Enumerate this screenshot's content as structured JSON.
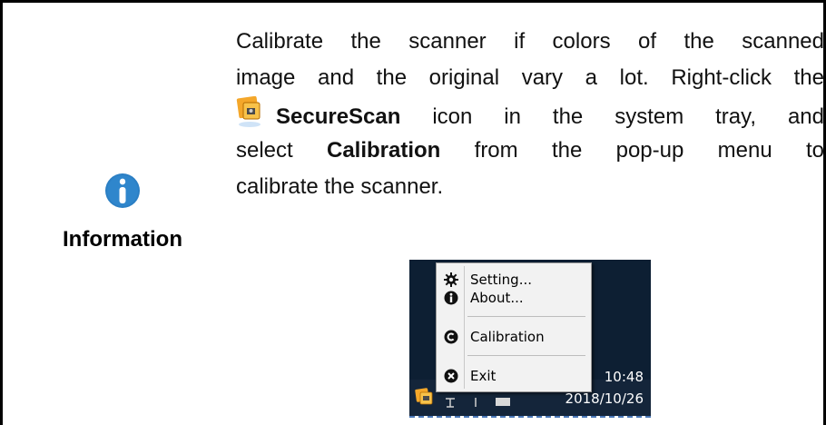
{
  "note": {
    "label": "Information",
    "icon": "info-icon",
    "lines": [
      "Calibrate the scanner if colors of the scanned",
      "image and the original vary a lot. Right-click the"
    ],
    "line3_bold": "SecureScan",
    "line3_rest": " icon in the system tray, and",
    "line4_pre": "select ",
    "line4_bold": "Calibration",
    "line4_rest": " from the pop-up menu to",
    "line5": "calibrate the scanner."
  },
  "tray_menu": {
    "items": [
      {
        "label": "Setting...",
        "icon": "gear-icon"
      },
      {
        "label": "About...",
        "icon": "info-icon"
      },
      {
        "label": "Calibration",
        "icon": "calibration-icon"
      },
      {
        "label": "Exit",
        "icon": "exit-icon"
      }
    ],
    "time": "10:48",
    "date": "2018/10/26"
  },
  "colors": {
    "info_blue": "#2b7fc4",
    "tray_bg": "#0d1f33"
  }
}
